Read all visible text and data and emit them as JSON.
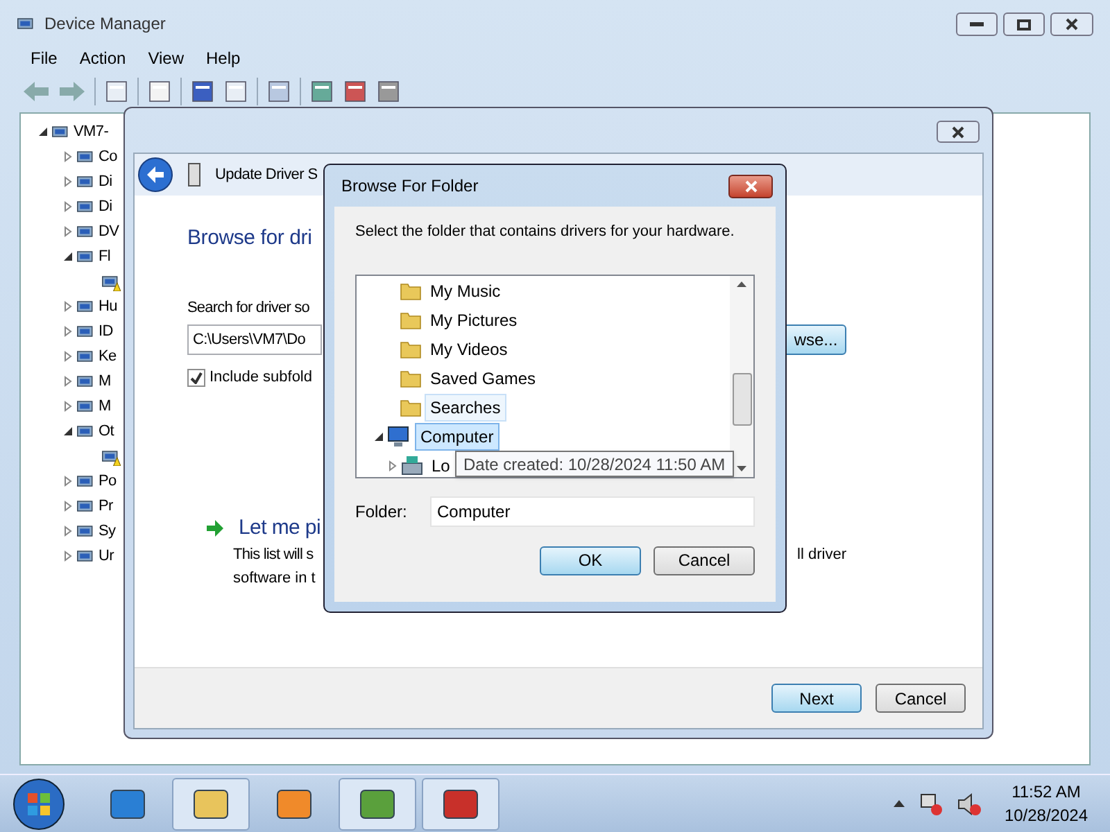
{
  "device_manager": {
    "title": "Device Manager",
    "menu": [
      "File",
      "Action",
      "View",
      "Help"
    ],
    "tree": {
      "label": "VM7-",
      "expanded": true,
      "children": [
        {
          "label": "Co",
          "expanded": false
        },
        {
          "label": "Di",
          "expanded": false
        },
        {
          "label": "Di",
          "expanded": false
        },
        {
          "label": "DV",
          "expanded": false
        },
        {
          "label": "Fl",
          "expanded": true,
          "children": [
            {
              "warning": true
            }
          ]
        },
        {
          "label": "Hu",
          "expanded": false
        },
        {
          "label": "ID",
          "expanded": false
        },
        {
          "label": "Ke",
          "expanded": false
        },
        {
          "label": "M",
          "expanded": false
        },
        {
          "label": "M",
          "expanded": false
        },
        {
          "label": "Ot",
          "expanded": true,
          "children": [
            {
              "warning": true
            }
          ]
        },
        {
          "label": "Po",
          "expanded": false
        },
        {
          "label": "Pr",
          "expanded": false
        },
        {
          "label": "Sy",
          "expanded": false
        },
        {
          "label": "Ur",
          "expanded": false
        }
      ]
    }
  },
  "wizard": {
    "title": "Update Driver S",
    "heading": "Browse for dri",
    "search_label": "Search for driver so",
    "path": "C:\\Users\\VM7\\Do",
    "browse_button": "wse...",
    "include_subfolders": {
      "label": "Include subfold",
      "checked": true
    },
    "pick_option": {
      "title": "Let me pi",
      "line1_left": "This list will s",
      "line1_right": "ll driver",
      "line2": "software in t"
    },
    "buttons": [
      {
        "label": "Next",
        "default": true
      },
      {
        "label": "Cancel",
        "default": false
      }
    ]
  },
  "browse_dialog": {
    "title": "Browse For Folder",
    "prompt": "Select the folder that contains drivers for your hardware.",
    "tree": [
      {
        "label": "My Music",
        "hovered": false,
        "selected": false
      },
      {
        "label": "My Pictures",
        "hovered": false,
        "selected": false
      },
      {
        "label": "My Videos",
        "hovered": false,
        "selected": false
      },
      {
        "label": "Saved Games",
        "hovered": false,
        "selected": false
      },
      {
        "label": "Searches",
        "hovered": true,
        "selected": false
      },
      {
        "label": "Computer",
        "hovered": false,
        "selected": true,
        "expanded": true,
        "children": [
          {
            "label": "Lo",
            "hovered": false,
            "selected": false,
            "expanded": false
          }
        ]
      }
    ],
    "tooltip": "Date created: 10/28/2024 11:50 AM",
    "folder_label": "Folder:",
    "folder_value": "Computer",
    "buttons": [
      {
        "label": "OK",
        "default": true
      },
      {
        "label": "Cancel",
        "default": false
      }
    ]
  },
  "taskbar": {
    "apps": [
      {
        "active": false
      },
      {
        "active": true
      },
      {
        "active": false
      },
      {
        "active": true
      },
      {
        "active": true
      }
    ],
    "time": "11:52 AM",
    "date": "10/28/2024"
  }
}
